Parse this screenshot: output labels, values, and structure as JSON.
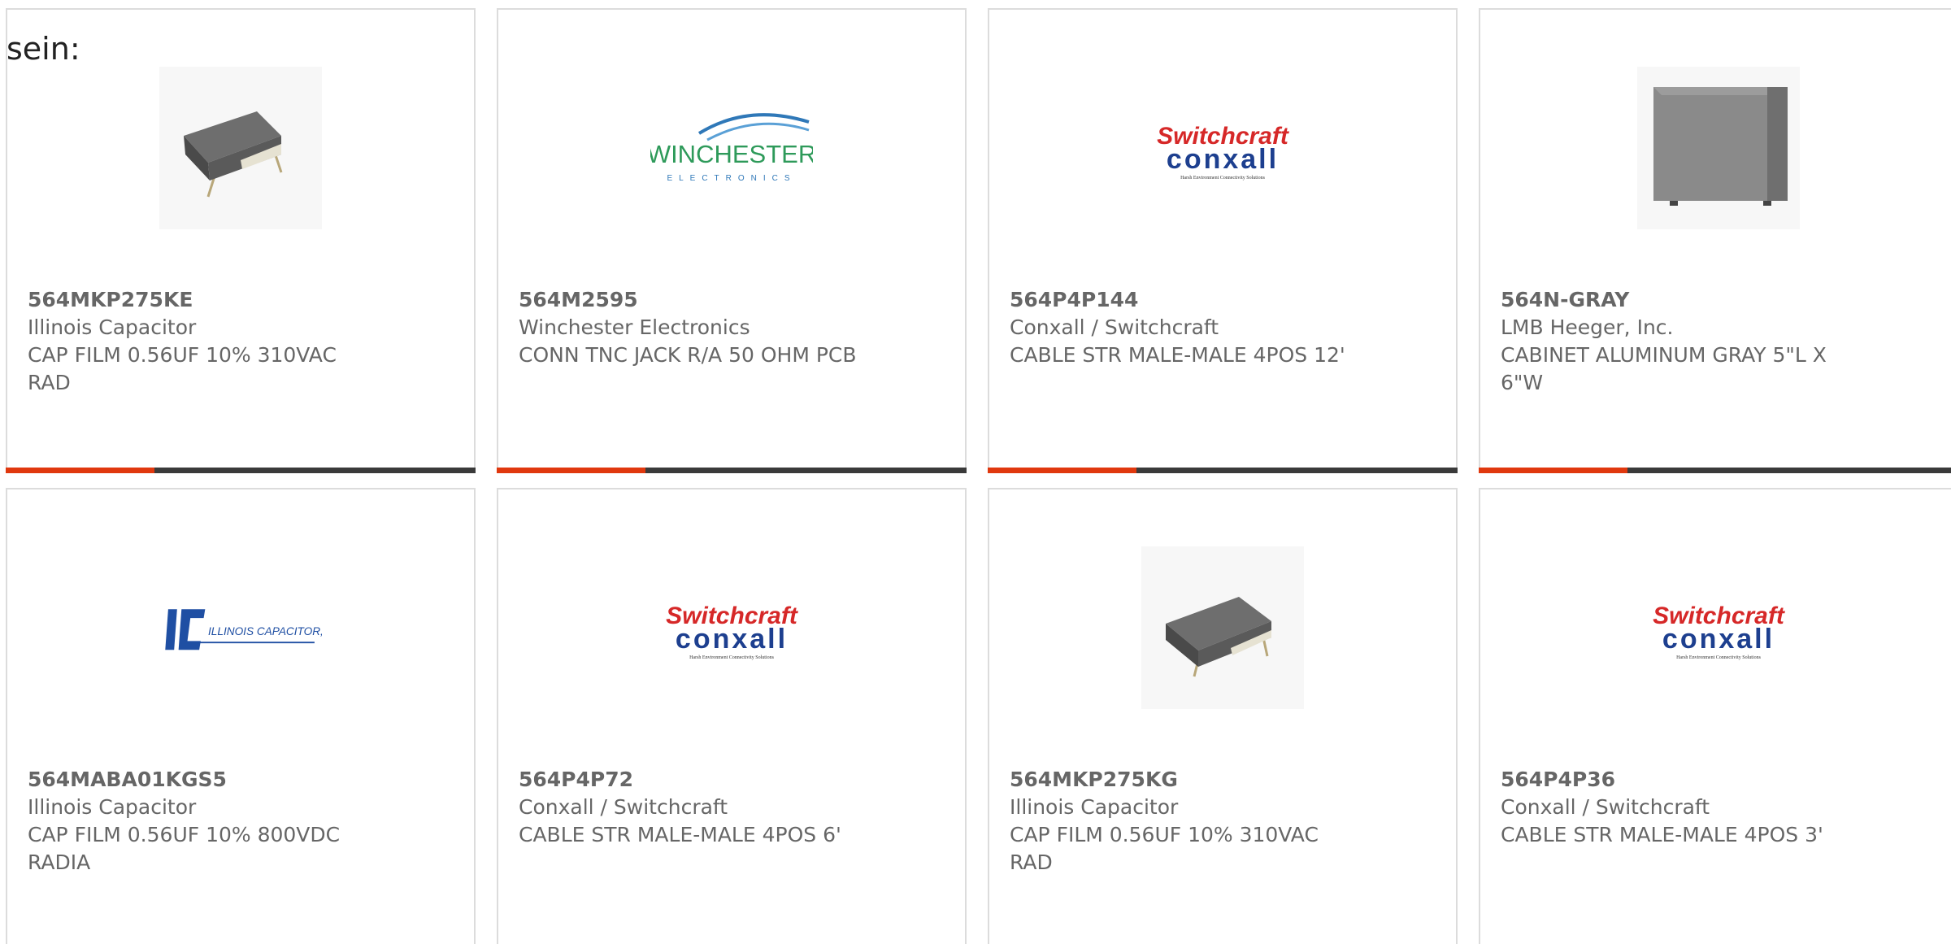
{
  "intro_text": "sein:",
  "products": [
    {
      "part_number": "564MKP275KE",
      "manufacturer": "Illinois Capacitor",
      "description": "CAP FILM 0.56UF 10% 310VAC RAD",
      "image": "film-capacitor-photo"
    },
    {
      "part_number": "564M2595",
      "manufacturer": "Winchester Electronics",
      "description": "CONN TNC JACK R/A 50 OHM PCB",
      "image": "winchester-electronics-logo",
      "logo": {
        "title": "WINCHESTER",
        "subtitle": "ELECTRONICS"
      }
    },
    {
      "part_number": "564P4P144",
      "manufacturer": "Conxall / Switchcraft",
      "description": "CABLE STR MALE-MALE 4POS 12'",
      "image": "switchcraft-conxall-logo",
      "logo": {
        "top": "Switchcraft",
        "bottom": "conxall",
        "tagline": "Harsh Environment Connectivity Solutions"
      }
    },
    {
      "part_number": "564N-GRAY",
      "manufacturer": "LMB Heeger, Inc.",
      "description": "CABINET ALUMINUM GRAY 5\"L X 6\"W",
      "image": "gray-cabinet-photo"
    },
    {
      "part_number": "564MABA01KGS5",
      "manufacturer": "Illinois Capacitor",
      "description": "CAP FILM 0.56UF 10% 800VDC RADIA",
      "image": "illinois-capacitor-logo",
      "logo": {
        "title": "ILLINOIS CAPACITOR, INC."
      }
    },
    {
      "part_number": "564P4P72",
      "manufacturer": "Conxall / Switchcraft",
      "description": "CABLE STR MALE-MALE 4POS 6'",
      "image": "switchcraft-conxall-logo",
      "logo": {
        "top": "Switchcraft",
        "bottom": "conxall",
        "tagline": "Harsh Environment Connectivity Solutions"
      }
    },
    {
      "part_number": "564MKP275KG",
      "manufacturer": "Illinois Capacitor",
      "description": "CAP FILM 0.56UF 10% 310VAC RAD",
      "image": "film-capacitor-photo"
    },
    {
      "part_number": "564P4P36",
      "manufacturer": "Conxall / Switchcraft",
      "description": "CABLE STR MALE-MALE 4POS 3'",
      "image": "switchcraft-conxall-logo",
      "logo": {
        "top": "Switchcraft",
        "bottom": "conxall",
        "tagline": "Harsh Environment Connectivity Solutions"
      }
    }
  ],
  "colors": {
    "accent_bar": "#e0380e",
    "dark_bar": "#3a3a3a",
    "switchcraft_red": "#d62828",
    "conxall_blue": "#1d3f8f",
    "winchester_green": "#2e9a5a",
    "illinois_blue": "#1f4fa3"
  }
}
